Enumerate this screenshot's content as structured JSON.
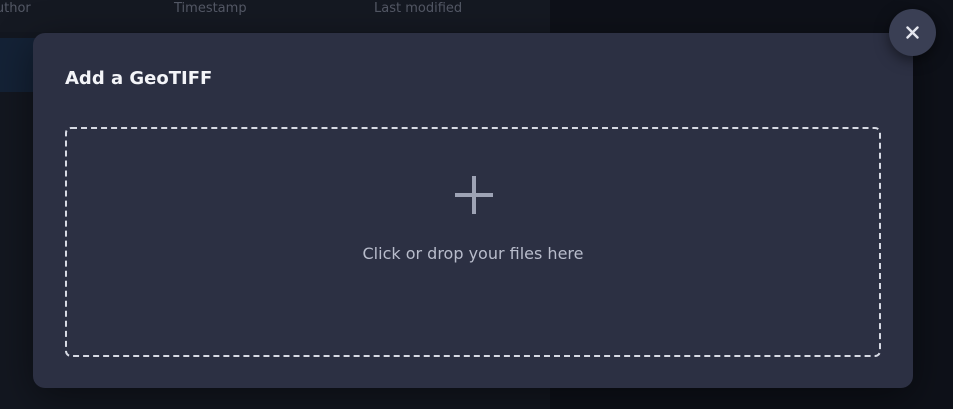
{
  "background": {
    "columns": {
      "author": "Author",
      "timestamp": "Timestamp",
      "last_modified": "Last modified"
    }
  },
  "modal": {
    "title": "Add a GeoTIFF",
    "dropzone": {
      "icon": "plus-icon",
      "label": "Click or drop your files here"
    },
    "close": {
      "icon": "close-icon"
    }
  },
  "colors": {
    "page_background": "#12151e",
    "modal_background": "#2c3043",
    "dropzone_border": "#d7dae4",
    "title_text": "#f3f4f8",
    "muted_text": "#b8bccb",
    "highlight_row": "#1b2f4a"
  }
}
